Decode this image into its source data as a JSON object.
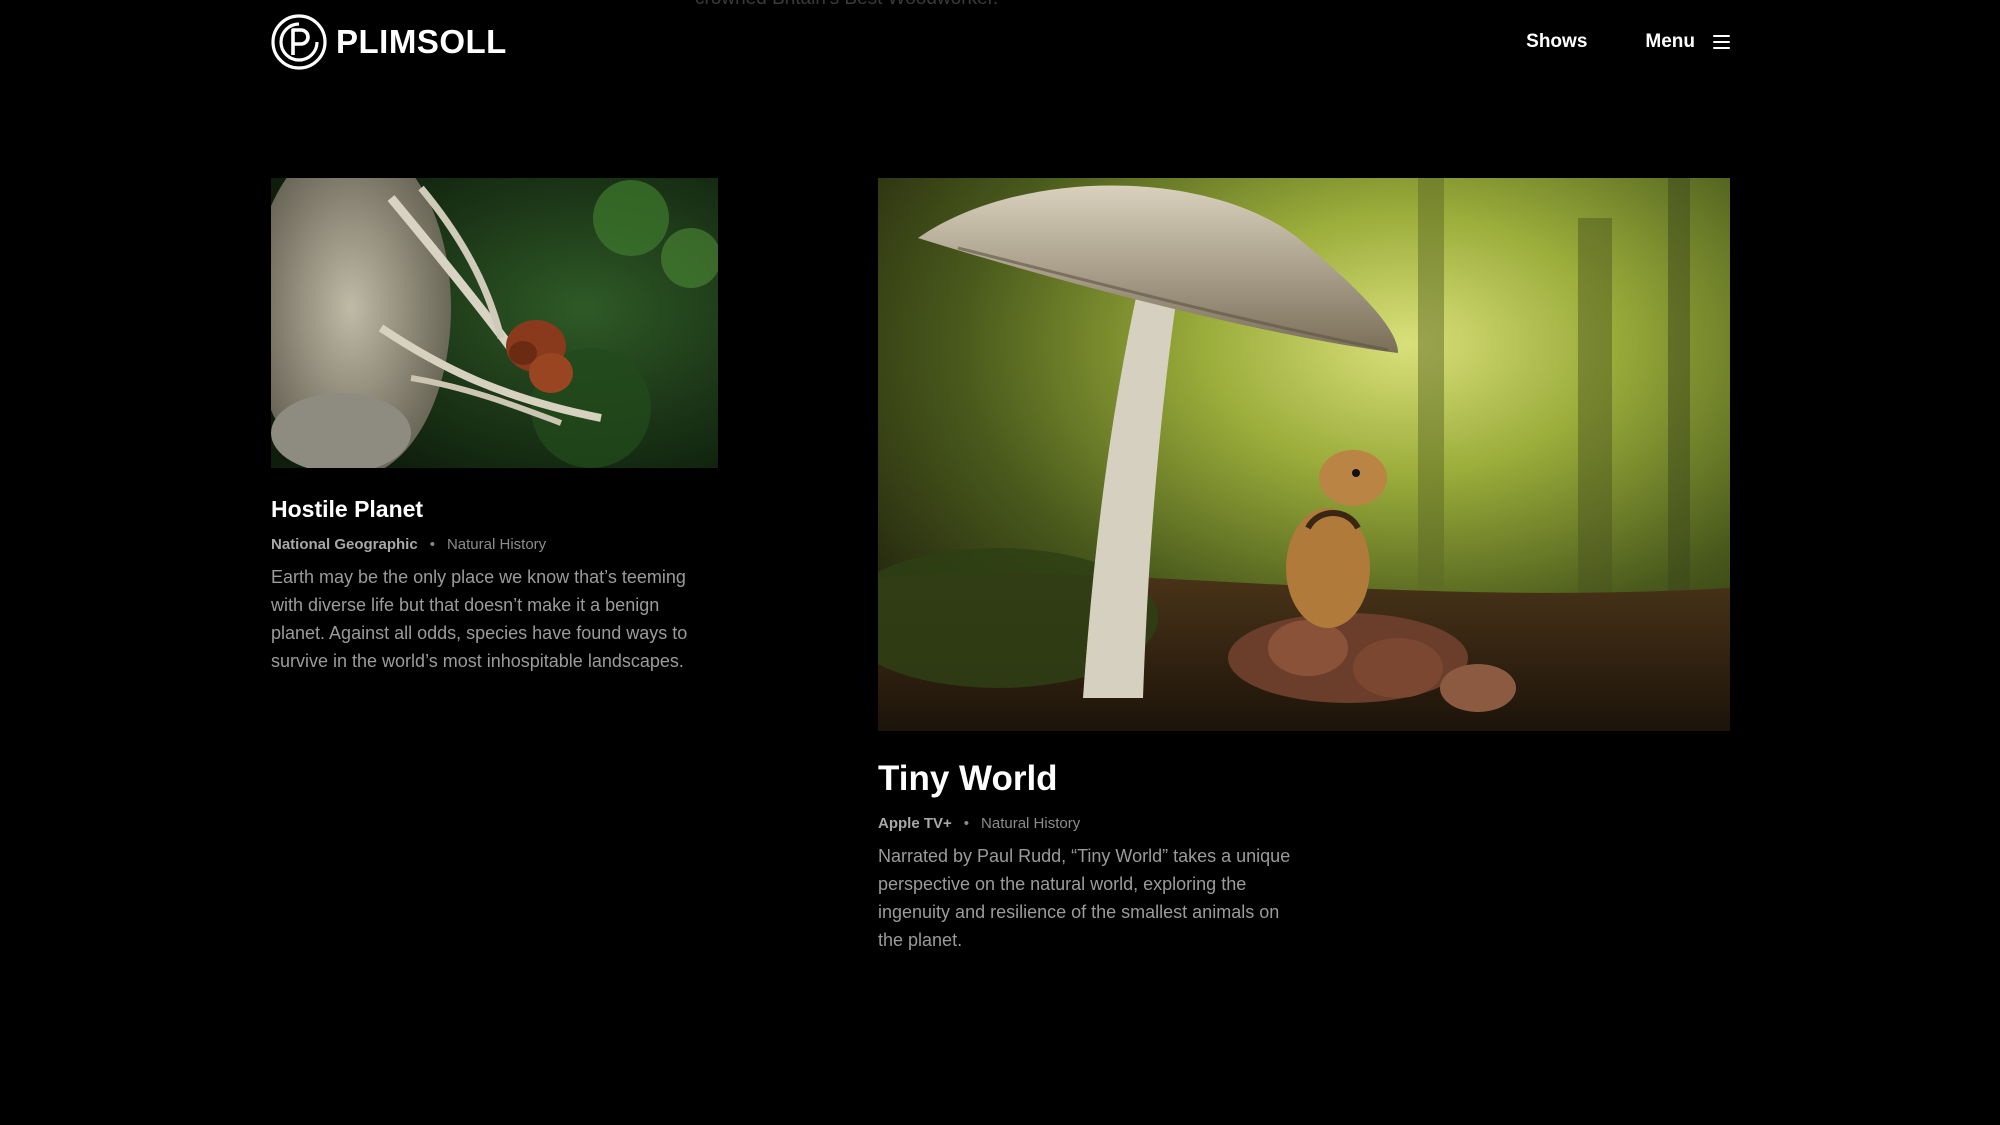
{
  "top_fragment": "crowned Britain's Best Woodworker.",
  "header": {
    "logo_text": "PLIMSOLL",
    "nav": {
      "shows_label": "Shows",
      "menu_label": "Menu"
    }
  },
  "cards": [
    {
      "title": "Hostile Planet",
      "network": "National Geographic",
      "separator": "•",
      "genre": "Natural History",
      "description": "Earth may be the only place we know that’s teeming with diverse life but that doesn’t make it a benign planet. Against all odds, species have found ways to survive in the world’s most inhospitable landscapes."
    },
    {
      "title": "Tiny World",
      "network": "Apple TV+",
      "separator": "•",
      "genre": "Natural History",
      "description": "Narrated by Paul Rudd, “Tiny World” takes a unique perspective on the natural world, exploring the ingenuity and resilience of the smallest animals on the planet."
    }
  ],
  "colors": {
    "background": "#000000",
    "text_primary": "#ffffff",
    "text_secondary": "#9b9b9b"
  }
}
